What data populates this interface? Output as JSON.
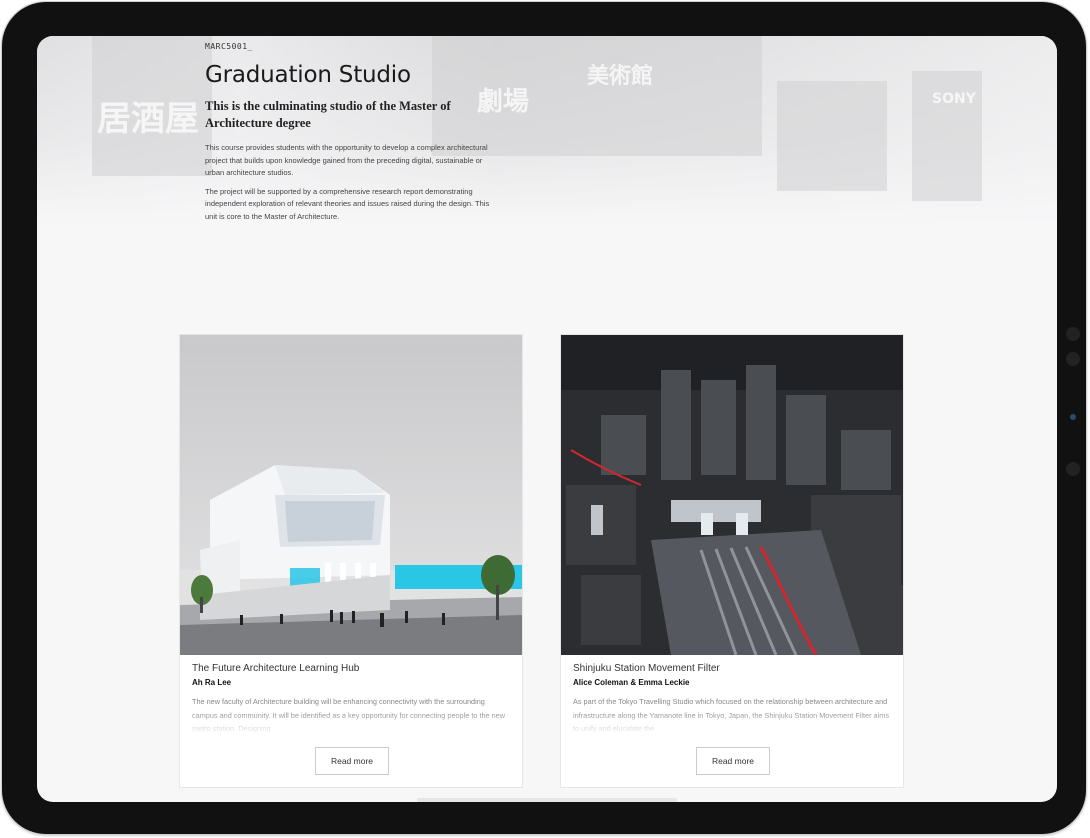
{
  "hero": {
    "course_code": "MARC5001_",
    "title": "Graduation Studio",
    "subtitle": "This is the culminating studio of the Master of Architecture degree",
    "paragraphs": [
      "This course provides students with the opportunity to develop a complex architectural project that builds upon knowledge gained from the preceding digital, sustainable or urban architecture studios.",
      "The project will be supported by a comprehensive research report demonstrating independent exploration of relevant theories and issues raised during the design. This unit is core to the Master of Architecture."
    ],
    "background_signs": [
      "美術館",
      "居酒屋",
      "劇場",
      "SONY"
    ]
  },
  "cards": [
    {
      "title": "The Future Architecture Learning Hub",
      "author": "Ah Ra Lee",
      "excerpt": "The new faculty of Architecture building will be enhancing connectivity with the surrounding campus and community. It will be identified as a key opportunity for connecting people to the new metro station. Designing",
      "button": "Read more"
    },
    {
      "title": "Shinjuku Station Movement Filter",
      "author": "Alice Coleman & Emma Leckie",
      "excerpt": "As part of the Tokyo Travelling Studio which focused on the relationship between architecture and infrastructure along the Yamanote line in Tokyo, Japan, the Shinjuku Station Movement Filter aims to unify and elucidate the",
      "button": "Read more"
    }
  ],
  "colors": {
    "device_frame": "#111111",
    "screen_bg": "#f7f7f8",
    "accent_cyan": "#29c6e6",
    "text_dark": "#1a1a1a"
  }
}
